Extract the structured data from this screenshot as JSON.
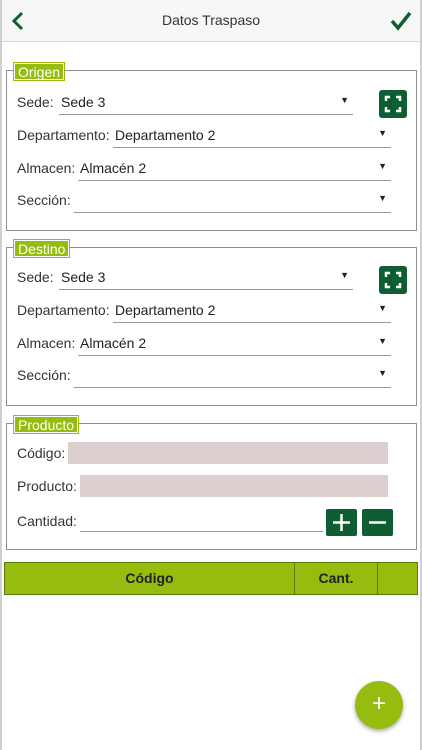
{
  "header": {
    "title": "Datos Traspaso"
  },
  "origen": {
    "legend": "Origen",
    "sede_label": "Sede:",
    "sede_value": "Sede 3",
    "departamento_label": "Departamento:",
    "departamento_value": "Departamento 2",
    "almacen_label": "Almacen:",
    "almacen_value": "Almacén 2",
    "seccion_label": "Sección:",
    "seccion_value": ""
  },
  "destino": {
    "legend": "Destino",
    "sede_label": "Sede:",
    "sede_value": "Sede 3",
    "departamento_label": "Departamento:",
    "departamento_value": "Departamento 2",
    "almacen_label": "Almacen:",
    "almacen_value": "Almacén 2",
    "seccion_label": "Sección:",
    "seccion_value": ""
  },
  "producto": {
    "legend": "Producto",
    "codigo_label": "Código:",
    "producto_label": "Producto:",
    "cantidad_label": "Cantidad:"
  },
  "table": {
    "col_codigo": "Código",
    "col_cant": "Cant."
  },
  "colors": {
    "accent": "#96bc0f",
    "button": "#0f5e33",
    "grey_input": "#dbcfcf"
  }
}
